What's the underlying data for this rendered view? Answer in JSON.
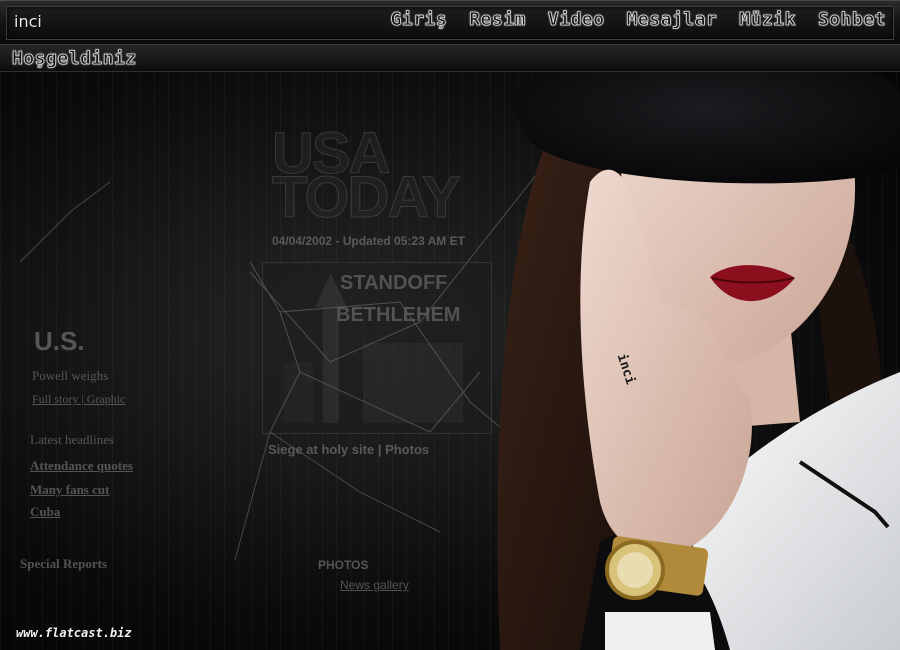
{
  "header": {
    "brand": "inci",
    "nav": [
      "Giriş",
      "Resim",
      "Video",
      "Mesajlar",
      "Müzik",
      "Sohbet"
    ]
  },
  "ticker": {
    "text": "Hoşgeldiniz"
  },
  "background": {
    "newspaper_headlines": [
      "USA TODAY",
      "04/04/2002 - Updated 05:23 AM ET",
      "STANDOFF",
      "BETHLEHEM",
      "U.S.",
      "Powell weighs",
      "Full story | Graphic",
      "Latest headlines",
      "Attendance quotes",
      "Many fans cut",
      "Cuba",
      "Special Reports",
      "Siege at holy site | Photos",
      "PHOTOS",
      "News gallery"
    ]
  },
  "tattoo": "inci",
  "watermark": "www.flatcast.biz",
  "colors": {
    "background": "#050505",
    "bar": "#1a1a1a",
    "lip": "#8b0f1c",
    "shirt": "#f2f4f6"
  }
}
